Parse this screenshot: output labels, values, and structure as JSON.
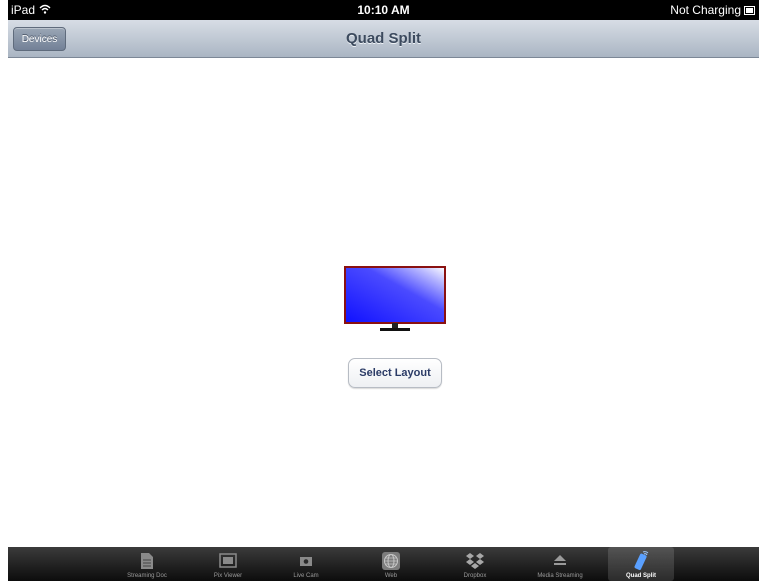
{
  "status_bar": {
    "device": "iPad",
    "time": "10:10 AM",
    "charging": "Not Charging"
  },
  "nav": {
    "title": "Quad Split",
    "devices_button": "Devices"
  },
  "main": {
    "select_layout_button": "Select Layout",
    "tv_icon": "tv-monitor-icon"
  },
  "tabs": [
    {
      "label": "Streaming Doc",
      "icon": "document-icon",
      "selected": false
    },
    {
      "label": "Pix Viewer",
      "icon": "photo-icon",
      "selected": false
    },
    {
      "label": "Live Cam",
      "icon": "camera-icon",
      "selected": false
    },
    {
      "label": "Web",
      "icon": "globe-icon",
      "selected": false
    },
    {
      "label": "Dropbox",
      "icon": "dropbox-icon",
      "selected": false
    },
    {
      "label": "Media Streaming",
      "icon": "media-streaming-icon",
      "selected": false
    },
    {
      "label": "Quad Split",
      "icon": "remote-icon",
      "selected": true
    }
  ]
}
